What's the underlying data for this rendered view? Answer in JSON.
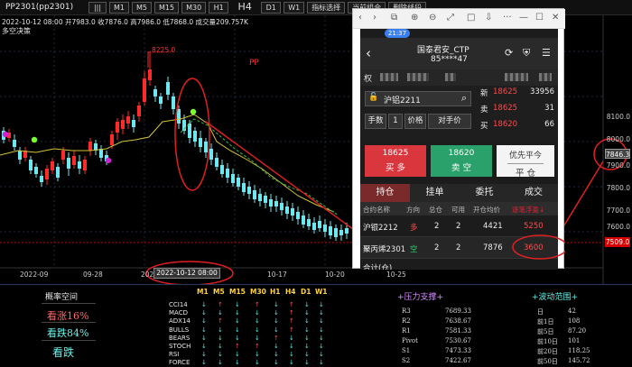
{
  "toolbar": {
    "symbol": "PP2301(pp2301)",
    "timeframes": [
      "M1",
      "M5",
      "M15",
      "M30",
      "H1",
      "H4",
      "D1",
      "W1"
    ],
    "active_timeframe": "H4",
    "buttons": [
      "指标选择",
      "当前组合",
      "删除线段"
    ]
  },
  "chart": {
    "info": {
      "datetime": "2022-10-12 08:00",
      "open_label": "开",
      "open": "7983.0",
      "close_label": "收",
      "close": "7876.0",
      "high_label": "高",
      "high": "7986.0",
      "low_label": "低",
      "low": "7868.0",
      "volume_label": "成交量",
      "volume": "209.757K"
    },
    "strategy_label": "多空决策",
    "pp_label": "PP",
    "peak_label": "8225.0",
    "price_axis": [
      "8100.0",
      "8000.0",
      "7900.0",
      "7800.0",
      "7700.0",
      "7600.0",
      "7500.0"
    ],
    "current_price": "7846.3",
    "low_price": "7509.0",
    "date_axis": [
      "2022-09",
      "09-28",
      "2022-10",
      "10-17",
      "10-20",
      "10-25"
    ],
    "cursor_date": "2022-10-12 08:00",
    "accent_up": "#ff2a2a",
    "accent_down": "#6ee8f0",
    "annotation_color": "#e02020"
  },
  "phone": {
    "window_controls": [
      "‹",
      "›",
      "⧉",
      "⊕",
      "⊖",
      "⤢",
      "□",
      "⇩",
      "···",
      "—",
      "☐",
      "✕"
    ],
    "status_time": "21:37",
    "broker": "国泰君安_CTP",
    "account": "85****47",
    "header_icons": [
      "⟳",
      "⛨",
      "☰"
    ],
    "tab_first": "权",
    "contract": "沪铝2211",
    "qty_label": "手数",
    "qty": "1",
    "price_label": "价格",
    "price_mode": "对手价",
    "quote": [
      {
        "label": "新",
        "price": "18625",
        "size": "33956"
      },
      {
        "label": "卖",
        "price": "18625",
        "size": "31"
      },
      {
        "label": "买",
        "price": "18620",
        "size": "66"
      }
    ],
    "buy": {
      "price": "18625",
      "label": "买 多"
    },
    "sell": {
      "price": "18620",
      "label": "卖 空"
    },
    "close_btn": {
      "top": "优先平今",
      "bottom": "平 仓"
    },
    "tabs": [
      "持仓",
      "挂单",
      "委托",
      "成交"
    ],
    "active_tab": "持仓",
    "table_headers": [
      "合约名称",
      "方向",
      "总仓",
      "可用",
      "开仓均价",
      "逐笔浮盈↓"
    ],
    "positions": [
      {
        "name": "沪银2212",
        "dir": "多",
        "total": "2",
        "avail": "2",
        "avg": "4421",
        "pnl": "5250"
      },
      {
        "name": "聚丙烯2301",
        "dir": "空",
        "total": "2",
        "avail": "2",
        "avg": "7876",
        "pnl": "3600"
      },
      {
        "name": "合计(仓)",
        "dir": "",
        "total": "",
        "avail": "",
        "avg": "",
        "pnl": ""
      }
    ]
  },
  "bottom": {
    "prob": {
      "title": "概率空间",
      "up": "看涨16%",
      "down": "看跌84%",
      "verdict": "看跌"
    },
    "tf_headers": [
      "M1",
      "M5",
      "M15",
      "M30",
      "H1",
      "H4",
      "D1",
      "W1"
    ],
    "indicators": [
      {
        "name": "CCI14",
        "arrows": [
          "dn",
          "up",
          "dn",
          "up",
          "dn",
          "up",
          "dn",
          "dn"
        ]
      },
      {
        "name": "MACD",
        "arrows": [
          "dn",
          "dn",
          "dn",
          "dn",
          "dn",
          "up",
          "dn",
          "dn"
        ]
      },
      {
        "name": "ADX14",
        "arrows": [
          "dn",
          "up",
          "dn",
          "dn",
          "dn",
          "up",
          "dn",
          "dn"
        ]
      },
      {
        "name": "BULLS",
        "arrows": [
          "dn",
          "dn",
          "dn",
          "dn",
          "dn",
          "up",
          "dn",
          "dn"
        ]
      },
      {
        "name": "BEARS",
        "arrows": [
          "dn",
          "dn",
          "dn",
          "dn",
          "up",
          "dn",
          "dn",
          "dn"
        ]
      },
      {
        "name": "STOCH",
        "arrows": [
          "dn",
          "dn",
          "up",
          "up",
          "dn",
          "dn",
          "dn",
          "dn"
        ]
      },
      {
        "name": "RSI",
        "arrows": [
          "dn",
          "dn",
          "dn",
          "dn",
          "dn",
          "dn",
          "dn",
          "dn"
        ]
      },
      {
        "name": "FORCE",
        "arrows": [
          "dn",
          "dn",
          "dn",
          "dn",
          "dn",
          "dn",
          "dn",
          "dn"
        ]
      }
    ],
    "pivot": {
      "title": "+压力支撑+",
      "rows": [
        {
          "k": "R3",
          "v": "7689.33"
        },
        {
          "k": "R2",
          "v": "7638.67"
        },
        {
          "k": "R1",
          "v": "7581.33"
        },
        {
          "k": "Pivot",
          "v": "7530.67"
        },
        {
          "k": "S1",
          "v": "7473.33"
        },
        {
          "k": "S2",
          "v": "7422.67"
        }
      ]
    },
    "range": {
      "title": "+波动范围+",
      "rows": [
        {
          "k": "日",
          "v": "42"
        },
        {
          "k": "前1日",
          "v": "108"
        },
        {
          "k": "前5日",
          "v": "87.20"
        },
        {
          "k": "前10日",
          "v": "101"
        },
        {
          "k": "前20日",
          "v": "118.25"
        },
        {
          "k": "前50日",
          "v": "145.72"
        }
      ]
    }
  }
}
